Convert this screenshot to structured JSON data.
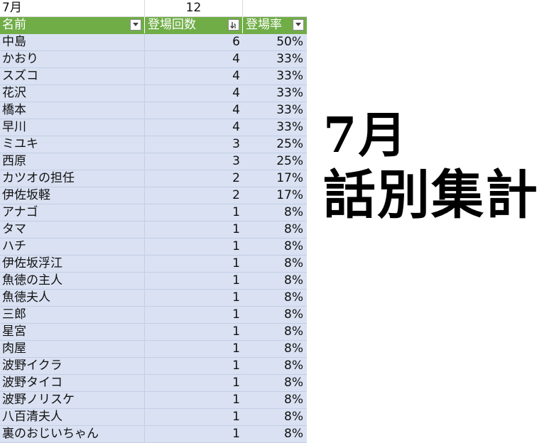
{
  "top": {
    "month": "7月",
    "total": "12"
  },
  "headers": {
    "name": "名前",
    "count": "登場回数",
    "rate": "登場率"
  },
  "rows": [
    {
      "name": "中島",
      "count": "6",
      "rate": "50%"
    },
    {
      "name": "かおり",
      "count": "4",
      "rate": "33%"
    },
    {
      "name": "スズコ",
      "count": "4",
      "rate": "33%"
    },
    {
      "name": "花沢",
      "count": "4",
      "rate": "33%"
    },
    {
      "name": "橋本",
      "count": "4",
      "rate": "33%"
    },
    {
      "name": "早川",
      "count": "4",
      "rate": "33%"
    },
    {
      "name": "ミユキ",
      "count": "3",
      "rate": "25%"
    },
    {
      "name": "西原",
      "count": "3",
      "rate": "25%"
    },
    {
      "name": "カツオの担任",
      "count": "2",
      "rate": "17%"
    },
    {
      "name": "伊佐坂軽",
      "count": "2",
      "rate": "17%"
    },
    {
      "name": "アナゴ",
      "count": "1",
      "rate": "8%"
    },
    {
      "name": "タマ",
      "count": "1",
      "rate": "8%"
    },
    {
      "name": "ハチ",
      "count": "1",
      "rate": "8%"
    },
    {
      "name": "伊佐坂浮江",
      "count": "1",
      "rate": "8%"
    },
    {
      "name": "魚徳の主人",
      "count": "1",
      "rate": "8%"
    },
    {
      "name": "魚徳夫人",
      "count": "1",
      "rate": "8%"
    },
    {
      "name": "三郎",
      "count": "1",
      "rate": "8%"
    },
    {
      "name": "星宮",
      "count": "1",
      "rate": "8%"
    },
    {
      "name": "肉屋",
      "count": "1",
      "rate": "8%"
    },
    {
      "name": "波野イクラ",
      "count": "1",
      "rate": "8%"
    },
    {
      "name": "波野タイコ",
      "count": "1",
      "rate": "8%"
    },
    {
      "name": "波野ノリスケ",
      "count": "1",
      "rate": "8%"
    },
    {
      "name": "八百清夫人",
      "count": "1",
      "rate": "8%"
    },
    {
      "name": "裏のおじいちゃん",
      "count": "1",
      "rate": "8%"
    }
  ],
  "title": {
    "line1": "7月",
    "line2": "話別集計"
  },
  "colors": {
    "header": "#70ad47",
    "row": "#d9e1f2",
    "grid": "#c3cfe6"
  },
  "icons": {
    "filter": "filter-dropdown-icon",
    "sort": "sort-descending-icon"
  }
}
